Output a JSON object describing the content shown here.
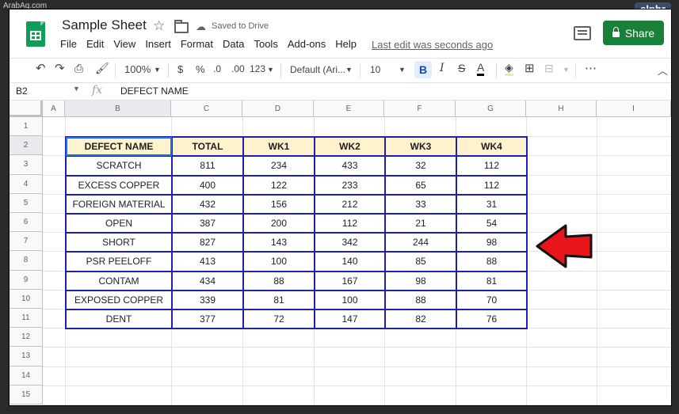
{
  "watermark": "ArabAq.com",
  "badge": "alphr",
  "doc": {
    "title": "Sample Sheet",
    "saved_status": "Saved to Drive",
    "last_edit": "Last edit was seconds ago",
    "share_label": "Share"
  },
  "menu": [
    "File",
    "Edit",
    "View",
    "Insert",
    "Format",
    "Data",
    "Tools",
    "Add-ons",
    "Help"
  ],
  "toolbar": {
    "zoom": "100%",
    "currency": "$",
    "percent": "%",
    "dec_decrease": ".0",
    "dec_increase": ".00",
    "more_formats": "123",
    "font": "Default (Ari...",
    "font_size": "10",
    "bold": "B",
    "italic": "I",
    "strike": "S",
    "text_color": "A",
    "more": "⋯"
  },
  "formula_bar": {
    "cell_ref": "B2",
    "fx": "fx",
    "value": "DEFECT NAME"
  },
  "columns": [
    "A",
    "B",
    "C",
    "D",
    "E",
    "F",
    "G",
    "H",
    "I"
  ],
  "rows": [
    "1",
    "2",
    "3",
    "4",
    "5",
    "6",
    "7",
    "8",
    "9",
    "10",
    "11",
    "12",
    "13",
    "14",
    "15"
  ],
  "table": {
    "header": [
      "DEFECT NAME",
      "TOTAL",
      "WK1",
      "WK2",
      "WK3",
      "WK4"
    ],
    "rows": [
      [
        "SCRATCH",
        "811",
        "234",
        "433",
        "32",
        "112"
      ],
      [
        "EXCESS COPPER",
        "400",
        "122",
        "233",
        "65",
        "112"
      ],
      [
        "FOREIGN MATERIAL",
        "432",
        "156",
        "212",
        "33",
        "31"
      ],
      [
        "OPEN",
        "387",
        "200",
        "112",
        "21",
        "54"
      ],
      [
        "SHORT",
        "827",
        "143",
        "342",
        "244",
        "98"
      ],
      [
        "PSR PEELOFF",
        "413",
        "100",
        "140",
        "85",
        "88"
      ],
      [
        "CONTAM",
        "434",
        "88",
        "167",
        "98",
        "81"
      ],
      [
        "EXPOSED COPPER",
        "339",
        "81",
        "100",
        "88",
        "70"
      ],
      [
        "DENT",
        "377",
        "72",
        "147",
        "82",
        "76"
      ]
    ]
  },
  "colors": {
    "border_blue": "#1e22a8",
    "header_fill": "#fff2cc",
    "arrow_red": "#e8161b",
    "share_green": "#188038"
  }
}
